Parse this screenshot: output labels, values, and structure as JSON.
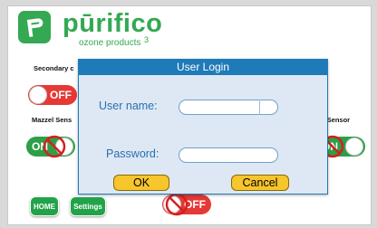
{
  "brand": {
    "name": "pūrifico",
    "tagline": "ozone products",
    "superscript": "3"
  },
  "sections": {
    "secondary": "Secondary c",
    "mazzel": "Mazzel Sens",
    "right_sensor": "d Sensor"
  },
  "toggles": {
    "secondary_state": "OFF",
    "mazzel_state": "ON",
    "right_sensor_state": "ON",
    "bottom_state": "OFF"
  },
  "nav": {
    "home": "HOME",
    "settings": "Settings"
  },
  "dialog": {
    "title": "User Login",
    "username_label": "User name:",
    "password_label": "Password:",
    "username_value": "",
    "password_value": "",
    "ok": "OK",
    "cancel": "Cancel"
  },
  "colors": {
    "brand_green": "#34a853",
    "dialog_blue": "#1f7ab8",
    "off_red": "#e53935",
    "button_yellow": "#f7c52c"
  }
}
